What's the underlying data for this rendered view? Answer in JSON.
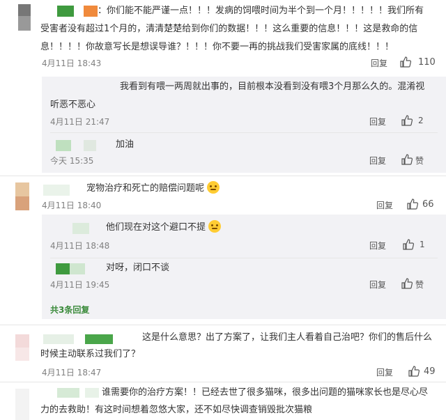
{
  "comments": [
    {
      "text_lines": [
        "：你们能不能严谨一点！！！发病的饲喂时间为半个到一个月！！！！！我们所有",
        "受害者没有超过1个月的，清清楚楚给到你们的数据！！！这么重要的信息！！！这是救命的信",
        "息！！！！你故意写长是想误导谁？！！！你不要一再的挑战我们受害家属的底线！！！"
      ],
      "time": "4月11日 18:43",
      "reply_label": "回复",
      "likes": "110",
      "replies": [
        {
          "text_lines": [
            "我看到有喂一两周就出事的，目前根本没看到没有喂3个月那么久的。混淆视",
            "听恶不恶心"
          ],
          "time": "4月11日 21:47",
          "reply_label": "回复",
          "likes": "2"
        },
        {
          "text": "加油",
          "time": "今天 15:35",
          "reply_label": "回复",
          "likes": "赞"
        }
      ]
    },
    {
      "text": "宠物治疗和死亡的赔偿问题呢",
      "time": "4月11日 18:40",
      "reply_label": "回复",
      "likes": "66",
      "replies": [
        {
          "text": "他们现在对这个避口不提",
          "time": "4月11日 18:48",
          "reply_label": "回复",
          "likes": "1"
        },
        {
          "text": "对呀，闭口不谈",
          "time": "4月11日 19:45",
          "reply_label": "回复",
          "likes": "赞"
        }
      ],
      "more_replies": "共3条回复"
    },
    {
      "text_lines": [
        "这是什么意思？出了方案了，让我们主人看着自己治吧？你们的售后什么",
        "时候主动联系过我们了？"
      ],
      "time": "4月11日 18:47",
      "reply_label": "回复",
      "likes": "49"
    },
    {
      "text_lines": [
        "谁需要你的治疗方案！！已经去世了很多猫咪，很多出问题的猫咪家长也是尽心尽",
        "力的去救助！有这时间想着忽悠大家，还不如尽快调查销毁批次猫粮"
      ]
    }
  ]
}
